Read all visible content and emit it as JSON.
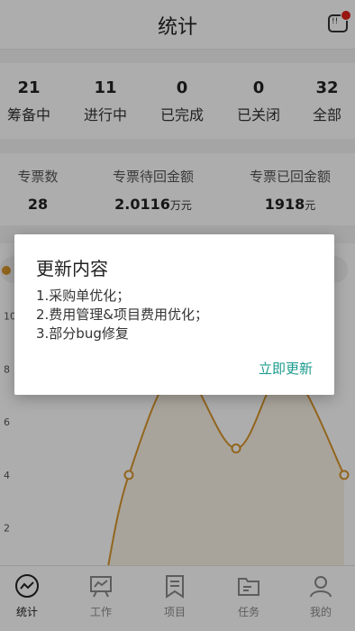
{
  "header": {
    "title": "统计",
    "msg_icon_text": "!!"
  },
  "status_counts": [
    {
      "num": "21",
      "label": "筹备中"
    },
    {
      "num": "11",
      "label": "进行中"
    },
    {
      "num": "0",
      "label": "已完成"
    },
    {
      "num": "0",
      "label": "已关闭"
    },
    {
      "num": "32",
      "label": "全部"
    }
  ],
  "invoice": [
    {
      "label": "专票数",
      "value": "28",
      "unit": ""
    },
    {
      "label": "专票待回金额",
      "value": "2.0116",
      "unit": "万元"
    },
    {
      "label": "专票已回金额",
      "value": "1918",
      "unit": "元"
    }
  ],
  "chart_data": {
    "type": "area",
    "y_ticks": [
      "10",
      "8",
      "6",
      "4",
      "2"
    ],
    "ylim": [
      1,
      10.5
    ],
    "points": [
      {
        "x": 0,
        "y": 0.2
      },
      {
        "x": 1,
        "y": 4
      },
      {
        "x": 2,
        "y": 8
      },
      {
        "x": 3,
        "y": 5
      },
      {
        "x": 4,
        "y": 8
      },
      {
        "x": 5,
        "y": 4
      }
    ],
    "color": "#d8962c"
  },
  "bottom_nav": [
    {
      "label": "统计",
      "icon": "chart-circle-icon",
      "active": true
    },
    {
      "label": "工作",
      "icon": "presentation-board-icon",
      "active": false
    },
    {
      "label": "项目",
      "icon": "bookmark-icon",
      "active": false
    },
    {
      "label": "任务",
      "icon": "folder-icon",
      "active": false
    },
    {
      "label": "我的",
      "icon": "user-icon",
      "active": false
    }
  ],
  "dialog": {
    "title": "更新内容",
    "lines": [
      "1.采购单优化；",
      "2.费用管理&项目费用优化；",
      "3.部分bug修复"
    ],
    "button": "立即更新"
  }
}
